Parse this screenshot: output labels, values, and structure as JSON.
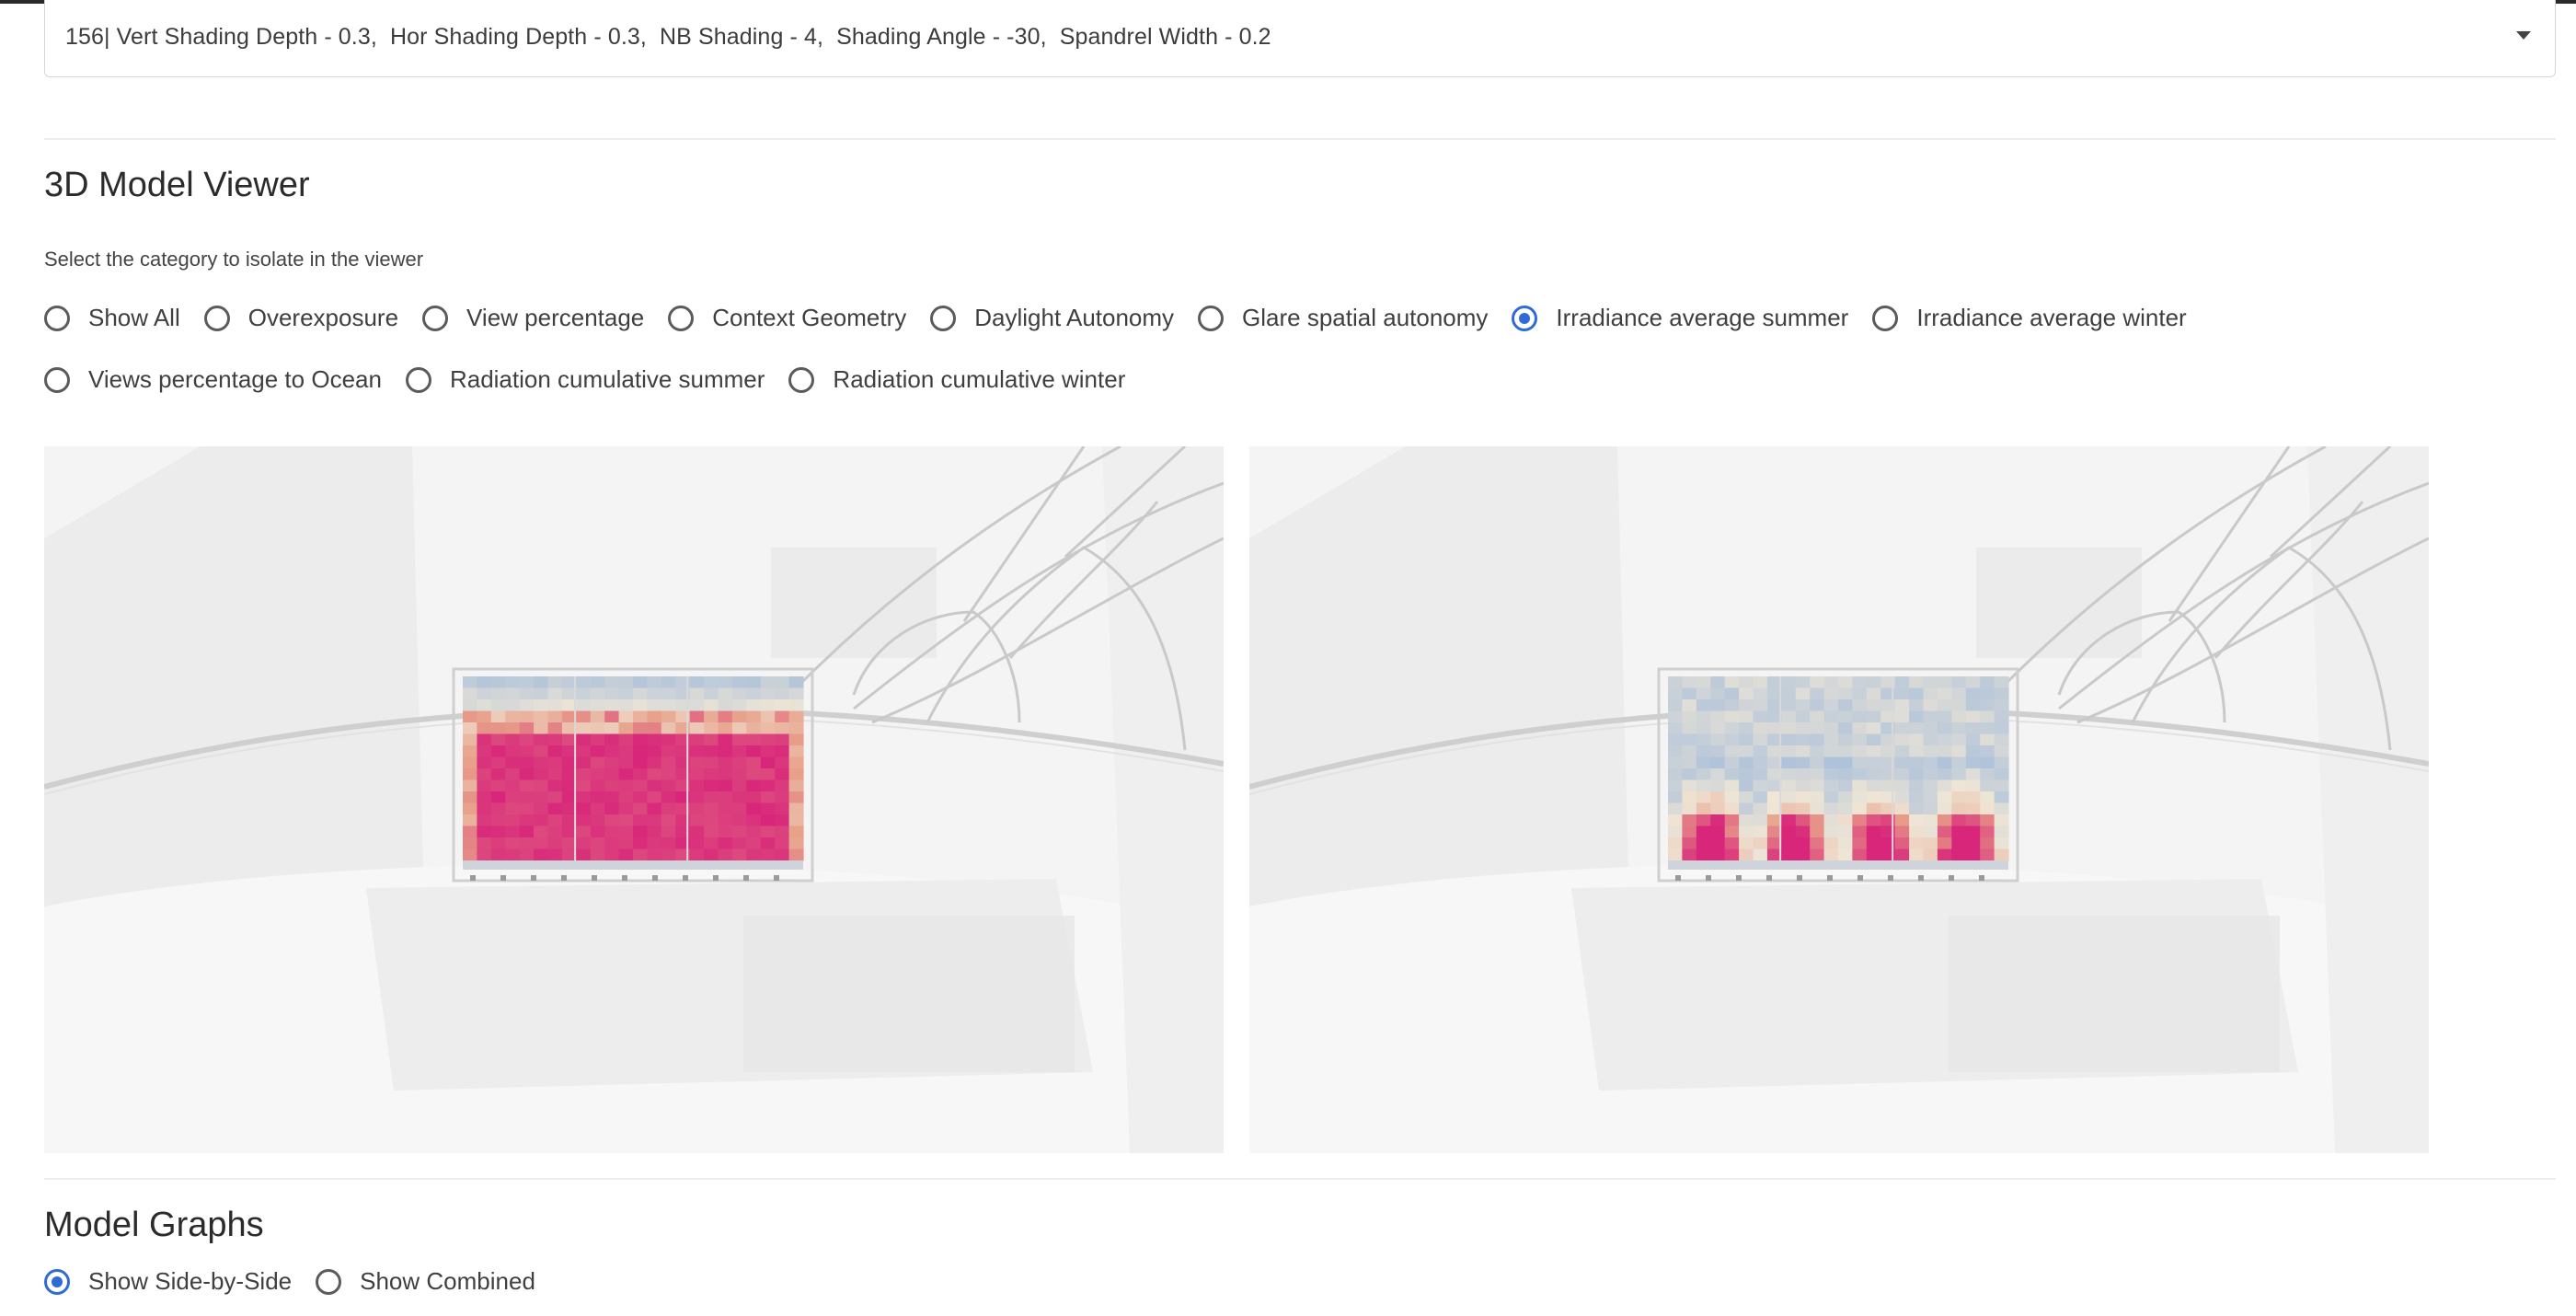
{
  "scenario_select": {
    "value": "156| Vert Shading Depth - 0.3,  Hor Shading Depth - 0.3,  NB Shading - 4,  Shading Angle - -30,  Spandrel Width - 0.2",
    "caret_icon": "chevron-down-icon"
  },
  "viewer_section": {
    "title": "3D Model Viewer",
    "helper": "Select the category to isolate in the viewer",
    "selected": "Irradiance average summer",
    "options_row1": [
      "Show All",
      "Overexposure",
      "View percentage",
      "Context Geometry",
      "Daylight Autonomy",
      "Glare spatial autonomy",
      "Irradiance average summer",
      "Irradiance average winter"
    ],
    "options_row2": [
      "Views percentage to Ocean",
      "Radiation cumulative summer",
      "Radiation cumulative winter"
    ]
  },
  "viewers": [
    {
      "name": "left-model-viewer",
      "heatmap": "high-irradiance"
    },
    {
      "name": "right-model-viewer",
      "heatmap": "low-irradiance"
    }
  ],
  "heatmap_colors": {
    "cool": "#a9bfda",
    "neutral": "#efe6d6",
    "warm": "#e8a08a",
    "hot": "#d8267a"
  },
  "graphs_section": {
    "title": "Model Graphs",
    "selected": "Show Side-by-Side",
    "options": [
      "Show Side-by-Side",
      "Show Combined"
    ]
  }
}
